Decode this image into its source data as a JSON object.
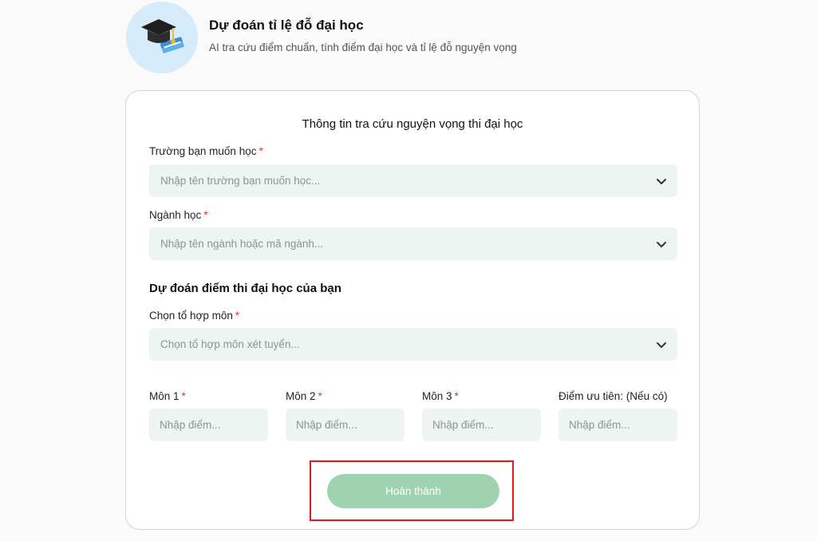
{
  "header": {
    "title": "Dự đoán tỉ lệ đỗ đại học",
    "subtitle": "AI tra cứu điểm chuẩn, tính điểm đại học và tỉ lệ đỗ nguyện vọng",
    "icon": "graduation-cap-books-icon"
  },
  "form": {
    "title": "Thông tin tra cứu nguyện vọng thi đại học",
    "required_mark": "*",
    "school": {
      "label": "Trường bạn muốn học",
      "placeholder": "Nhập tên trường bạn muốn học..."
    },
    "major": {
      "label": "Ngành học",
      "placeholder": "Nhập tên ngành hoặc mã ngành..."
    },
    "section_title": "Dự đoán điểm thi đại học của bạn",
    "combo": {
      "label": "Chọn tổ hợp môn",
      "placeholder": "Chọn tổ hợp môn xét tuyển..."
    },
    "scores": [
      {
        "label": "Môn 1",
        "placeholder": "Nhập điểm..."
      },
      {
        "label": "Môn 2",
        "placeholder": "Nhập điểm..."
      },
      {
        "label": "Môn 3",
        "placeholder": "Nhập điểm..."
      },
      {
        "label": "Điểm ưu tiên: (Nếu có)",
        "placeholder": "Nhập điểm..."
      }
    ],
    "submit_label": "Hoàn thành"
  },
  "colors": {
    "accent": "#9fd3af",
    "required": "#e0352b",
    "input_bg": "#eef4f2",
    "highlight_border": "#e01919"
  }
}
